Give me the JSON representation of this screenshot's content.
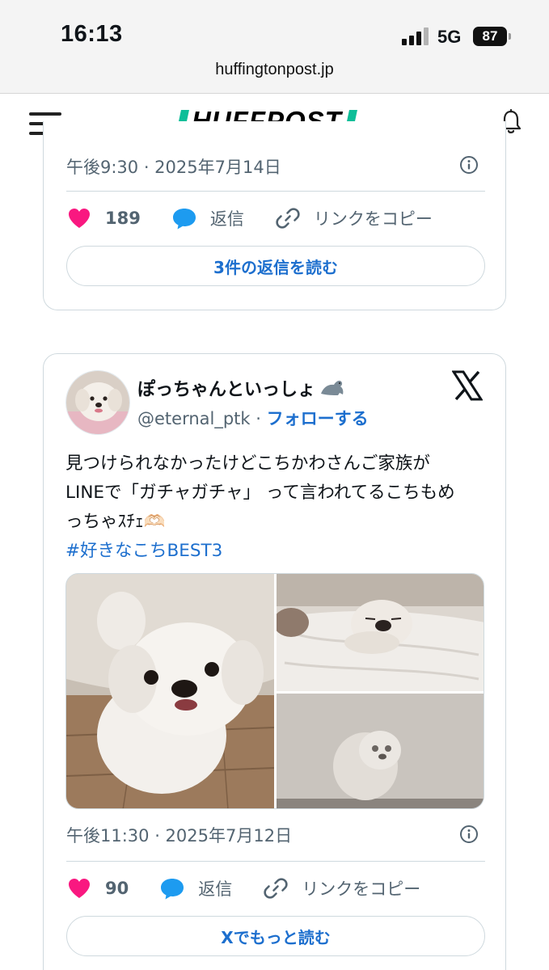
{
  "status_bar": {
    "time": "16:13",
    "network": "5G",
    "battery": "87",
    "url": "huffingtonpost.jp"
  },
  "header": {
    "logo_text": "HUFFPOST",
    "logo_accent_color": "#0dbe98",
    "menu_icon": "hamburger-menu-icon",
    "notification_icon": "bell-icon"
  },
  "tweets": [
    {
      "timestamp": "午後9:30 · 2025年7月14日",
      "likes": "189",
      "reply_label": "返信",
      "copy_link_label": "リンクをコピー",
      "read_more_label": "3件の返信を読む"
    },
    {
      "display_name": "ぽっちゃんといっしょ",
      "name_emoji_icon": "seal-icon",
      "handle": "@eternal_ptk",
      "separator": " · ",
      "follow_label": "フォローする",
      "text_lines": [
        "見つけられなかったけどこちかわさんご家族が",
        "LINEで「ガチャガチャ」 って言われてるこちもめ",
        "っちゃｽﾁｪ🫶🏻"
      ],
      "hashtag": "#好きなこちBEST3",
      "media_count": 3,
      "timestamp": "午後11:30 · 2025年7月12日",
      "likes": "90",
      "reply_label": "返信",
      "copy_link_label": "リンクをコピー",
      "read_more_label": "Xでもっと読む"
    }
  ],
  "colors": {
    "like_heart": "#f91880",
    "reply_bubble": "#1d9bf0",
    "link_blue": "#1d6fce",
    "muted_text": "#536471"
  }
}
